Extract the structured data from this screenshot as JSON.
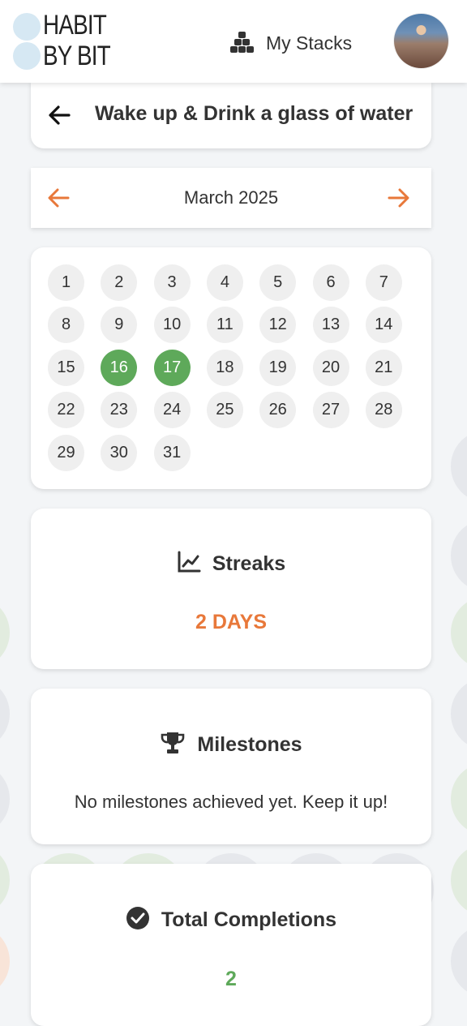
{
  "brand": {
    "line1": "HABIT",
    "line2": "BY BIT"
  },
  "nav": {
    "stacks_label": "My Stacks"
  },
  "habit": {
    "title": "Wake up & Drink a glass of water"
  },
  "calendar": {
    "month_label": "March 2025",
    "days": [
      "1",
      "2",
      "3",
      "4",
      "5",
      "6",
      "7",
      "8",
      "9",
      "10",
      "11",
      "12",
      "13",
      "14",
      "15",
      "16",
      "17",
      "18",
      "19",
      "20",
      "21",
      "22",
      "23",
      "24",
      "25",
      "26",
      "27",
      "28",
      "29",
      "30",
      "31"
    ],
    "completed_days": [
      "16",
      "17"
    ],
    "completed_color": "#5ea95a"
  },
  "streaks": {
    "heading": "Streaks",
    "value": "2 DAYS",
    "value_color": "#e8783a"
  },
  "milestones": {
    "heading": "Milestones",
    "message": "No milestones achieved yet. Keep it up!"
  },
  "completions": {
    "heading": "Total Completions",
    "value": "2",
    "value_color": "#5ea95a"
  },
  "colors": {
    "accent": "#e8783a",
    "success": "#5ea95a",
    "logo_dot": "#d6e8f3"
  },
  "icons": {
    "back": "arrow-left-icon",
    "prev": "arrow-left-icon",
    "next": "arrow-right-icon",
    "stacks": "stack-icon",
    "streaks": "line-chart-icon",
    "milestones": "trophy-icon",
    "completions": "check-circle-icon"
  }
}
